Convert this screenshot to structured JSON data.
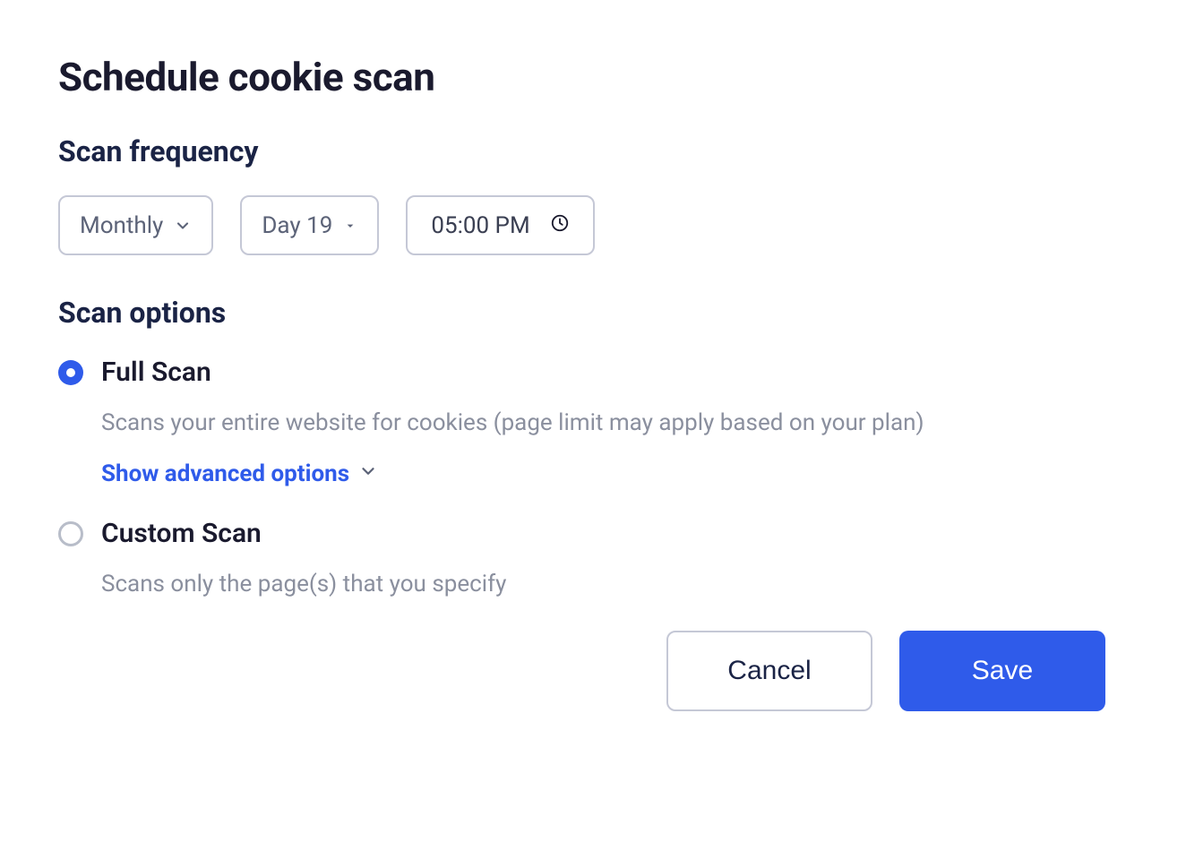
{
  "title": "Schedule cookie scan",
  "sections": {
    "frequency_heading": "Scan frequency",
    "options_heading": "Scan options"
  },
  "frequency": {
    "interval": "Monthly",
    "day": "Day 19",
    "time": "05:00 PM"
  },
  "scan_options": {
    "full": {
      "label": "Full Scan",
      "description": "Scans your entire website for cookies (page limit may apply based on your plan)",
      "advanced_link": "Show advanced options",
      "selected": true
    },
    "custom": {
      "label": "Custom Scan",
      "description": "Scans only the page(s) that you specify",
      "selected": false
    }
  },
  "footer": {
    "cancel": "Cancel",
    "save": "Save"
  }
}
